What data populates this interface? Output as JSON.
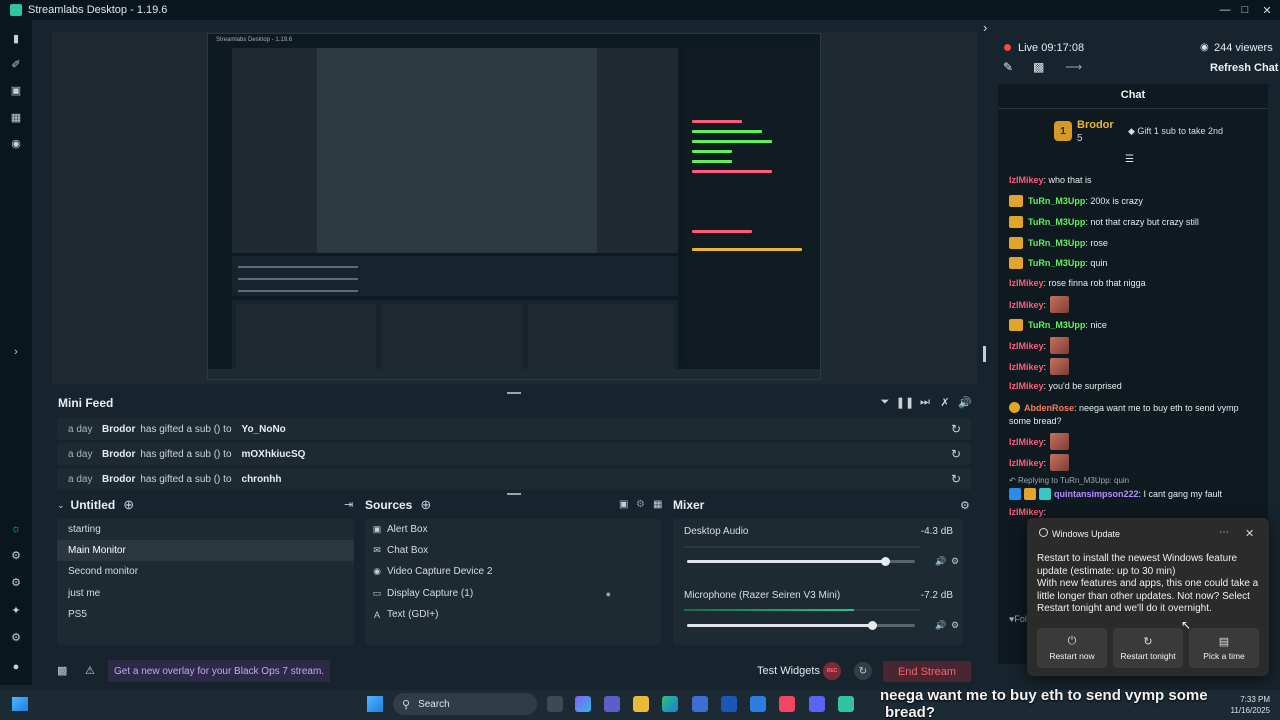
{
  "window": {
    "title": "Streamlabs Desktop - 1.19.6"
  },
  "preview": {
    "nested_title": "Streamlabs Desktop - 1.19.6"
  },
  "minifeed": {
    "title": "Mini Feed",
    "rows": [
      {
        "time": "a day",
        "user": "Brodor",
        "text": "has gifted a sub () to",
        "target": "Yo_NoNo"
      },
      {
        "time": "a day",
        "user": "Brodor",
        "text": "has gifted a sub () to",
        "target": "mOXhkiucSQ"
      },
      {
        "time": "a day",
        "user": "Brodor",
        "text": "has gifted a sub () to",
        "target": "chronhh"
      }
    ]
  },
  "scenes": {
    "title": "Untitled",
    "items": [
      "starting",
      "Main Monitor",
      "Second monitor",
      "just me",
      "PS5"
    ],
    "active_index": 1
  },
  "sources": {
    "title": "Sources",
    "items": [
      {
        "label": "Alert Box",
        "icon": "alert-box-icon"
      },
      {
        "label": "Chat Box",
        "icon": "chat-box-icon"
      },
      {
        "label": "Video Capture Device 2",
        "icon": "camera-icon"
      },
      {
        "label": "Display Capture (1)",
        "icon": "monitor-icon"
      },
      {
        "label": "Text (GDI+)",
        "icon": "text-icon"
      }
    ]
  },
  "mixer": {
    "title": "Mixer",
    "channels": [
      {
        "name": "Desktop Audio",
        "db": "-4.3 dB",
        "volume": 0.87,
        "level": 0.0
      },
      {
        "name": "Microphone (Razer Seiren V3 Mini)",
        "db": "-7.2 dB",
        "volume": 0.81,
        "level": 0.72
      }
    ]
  },
  "footer": {
    "message": "Get a new overlay for your Black Ops 7 stream.",
    "test_widgets": "Test Widgets",
    "rec_label": "REC",
    "end_stream": "End Stream"
  },
  "chat": {
    "live": "Live",
    "time": "09:17:08",
    "viewers": "244 viewers",
    "refresh": "Refresh Chat",
    "header": "Chat",
    "pinned": {
      "badge": "1",
      "name": "Brodor",
      "count": "5",
      "gift": "Gift 1 sub to take 2nd"
    },
    "reply_to": "Replying to TuRn_M3Upp: quin",
    "messages": [
      {
        "user": "IzIMikey",
        "text": ": who that is"
      },
      {
        "user": "TuRn_M3Upp",
        "text": ": 200x is crazy"
      },
      {
        "user": "TuRn_M3Upp",
        "text": ": not that crazy but crazy still"
      },
      {
        "user": "TuRn_M3Upp",
        "text": ": rose"
      },
      {
        "user": "TuRn_M3Upp",
        "text": ": quin"
      },
      {
        "user": "IzIMikey",
        "text": ": rose finna rob that nigga"
      },
      {
        "user": "IzIMikey",
        "text": ":"
      },
      {
        "user": "TuRn_M3Upp",
        "text": ": nice"
      },
      {
        "user": "IzIMikey",
        "text": ":"
      },
      {
        "user": "IzIMikey",
        "text": ":"
      },
      {
        "user": "IzIMikey",
        "text": ": you'd be surprised"
      },
      {
        "user": "AbdenRose",
        "text": ": neega want me to buy eth to send vymp"
      },
      {
        "user": "",
        "text": "some bread?"
      },
      {
        "user": "IzIMikey",
        "text": ":"
      },
      {
        "user": "IzIMikey",
        "text": ":"
      },
      {
        "user": "quintansimpson222",
        "text": ": I cant gang my fault"
      },
      {
        "user": "IzIMikey",
        "text": ":"
      }
    ],
    "follow_prefix": "Foll"
  },
  "toast": {
    "app": "Windows Update",
    "body_line1": "Restart to install the newest Windows feature update (estimate: up to 30 min)",
    "body_line2": "With new features and apps, this one could take a little longer than other updates. Not now? Select Restart tonight and we'll do it overnight.",
    "buttons": [
      "Restart now",
      "Restart tonight",
      "Pick a time"
    ]
  },
  "taskbar": {
    "search": "Search",
    "time": "7:33 PM",
    "date": "11/16/2025"
  },
  "overlay_caption": {
    "line1": "neega want me to buy eth to send vymp some",
    "line2": "bread?"
  },
  "colors": {
    "accent": "#31c3a2",
    "live": "#f2484f",
    "end_stream": "#ff5d73",
    "gift_gold": "#e7b53a"
  }
}
